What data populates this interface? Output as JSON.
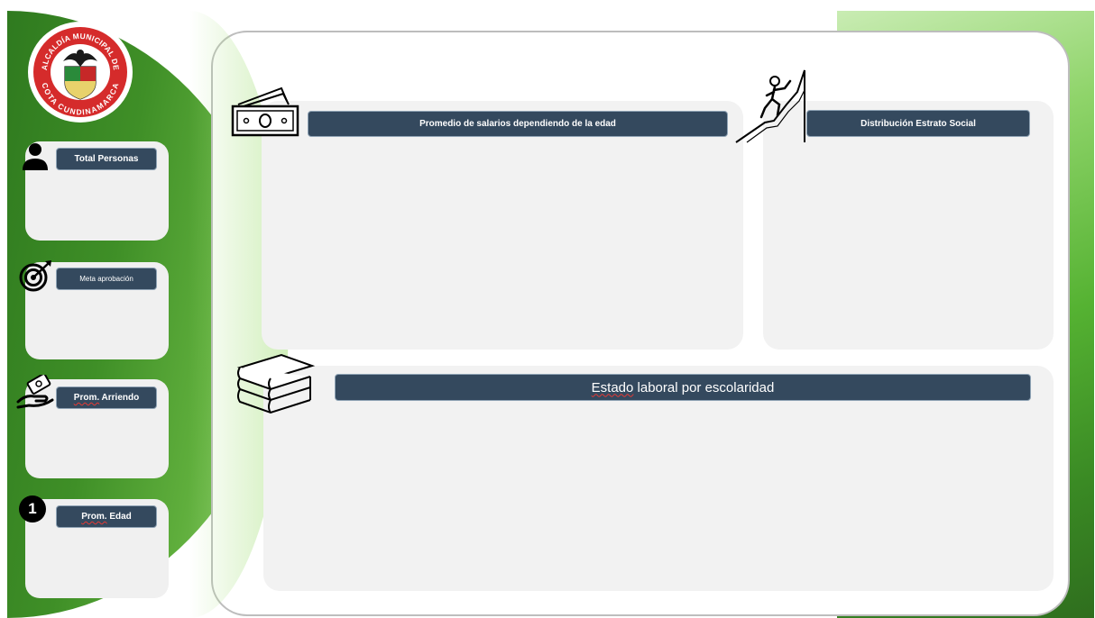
{
  "logo": {
    "text_top": "ALCALDÍA MUNICIPAL DE",
    "text_bottom": "COTA CUNDINAMARCA",
    "ring_color": "#d52b2b"
  },
  "kpis": [
    {
      "label": "Total Personas",
      "icon": "person-icon"
    },
    {
      "label": "Meta aprobación",
      "icon": "target-icon"
    },
    {
      "label_underlined": "Prom.",
      "label_rest": " Arriendo",
      "icon": "money-hand-icon"
    },
    {
      "label_underlined": "Prom.",
      "label_rest": " Edad",
      "icon": "number-one-icon",
      "badge": "1"
    }
  ],
  "sections": {
    "salarios": {
      "title": "Promedio de salarios dependiendo de la edad",
      "icon": "banknote-icon"
    },
    "estrato": {
      "title": "Distribución Estrato Social",
      "icon": "climber-icon"
    },
    "laboral": {
      "title_underlined": "Estado",
      "title_rest": " laboral por escolaridad",
      "icon": "books-icon"
    }
  },
  "colors": {
    "pill_bg": "#34495e",
    "green_dark": "#2f7a1f",
    "green_light": "#8fd06c",
    "card_bg": "#f2f2f2"
  }
}
